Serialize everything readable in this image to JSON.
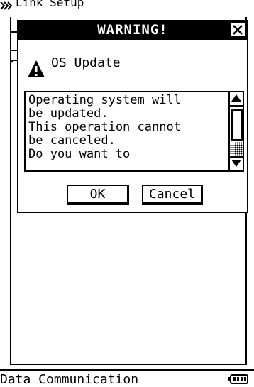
{
  "background": {
    "title": "Link Setup",
    "app_icon": "link-icon"
  },
  "dialog": {
    "title": "WARNING!",
    "close_icon": "close-icon",
    "icon": "warning-triangle-icon",
    "header": "OS Update",
    "message": "Operating system will\nbe updated.\nThis operation cannot\nbe canceled.\nDo you want to",
    "buttons": {
      "ok": "OK",
      "cancel": "Cancel"
    }
  },
  "statusbar": {
    "text": "Data Communication",
    "battery_icon": "battery-icon"
  }
}
